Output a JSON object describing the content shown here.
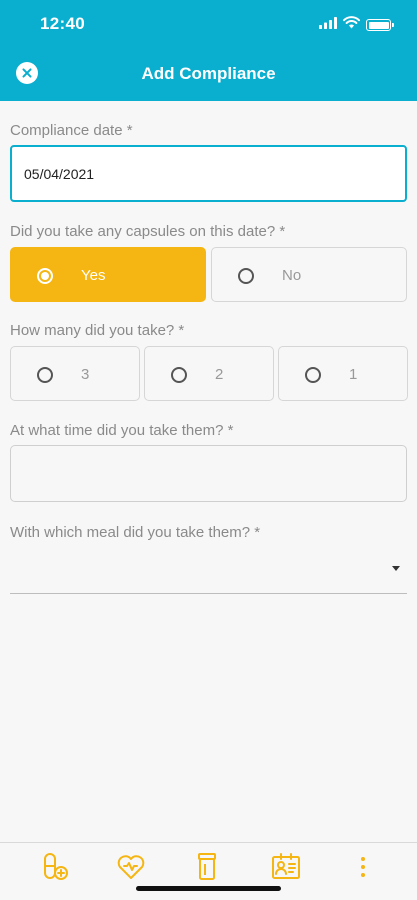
{
  "status_bar": {
    "time": "12:40"
  },
  "nav": {
    "title": "Add Compliance",
    "close_icon": "close-circle-icon"
  },
  "form": {
    "compliance_date": {
      "label": "Compliance date *",
      "value": "05/04/2021"
    },
    "took_capsules": {
      "label": "Did you take any capsules on this date? *",
      "options": [
        {
          "label": "Yes",
          "selected": true
        },
        {
          "label": "No",
          "selected": false
        }
      ]
    },
    "how_many": {
      "label": "How many did you take? *",
      "options": [
        {
          "label": "3",
          "selected": false
        },
        {
          "label": "2",
          "selected": false
        },
        {
          "label": "1",
          "selected": false
        }
      ]
    },
    "time_taken": {
      "label": "At what time did you take them? *",
      "value": ""
    },
    "meal": {
      "label": "With which meal did you take them? *",
      "value": ""
    }
  },
  "tab_bar": {
    "icons": [
      "pill-plus-icon",
      "heart-icon",
      "medicine-bottle-icon",
      "id-card-icon",
      "more-vertical-icon"
    ]
  },
  "colors": {
    "header": "#0aaecf",
    "accent": "#f5b613",
    "focus_border": "#0aaecf"
  }
}
